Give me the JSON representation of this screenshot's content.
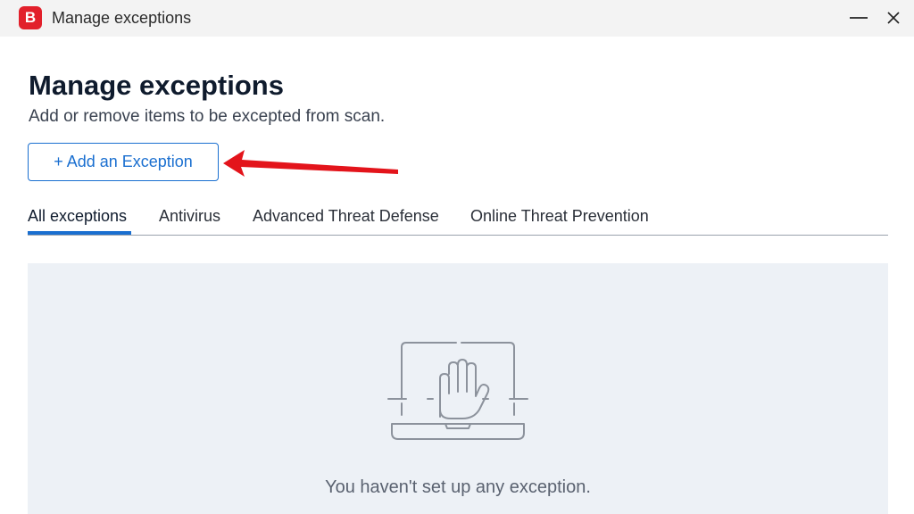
{
  "window": {
    "app_logo_letter": "B",
    "title": "Manage exceptions",
    "minimize_icon": "minimize-icon",
    "close_icon": "close-icon"
  },
  "header": {
    "title": "Manage exceptions",
    "subtitle": "Add or remove items to be excepted from scan."
  },
  "actions": {
    "add_exception_label": "+ Add an Exception"
  },
  "tabs": [
    {
      "label": "All exceptions",
      "active": true
    },
    {
      "label": "Antivirus",
      "active": false
    },
    {
      "label": "Advanced Threat Defense",
      "active": false
    },
    {
      "label": "Online Threat Prevention",
      "active": false
    }
  ],
  "empty_state": {
    "icon": "laptop-hand-stop-icon",
    "message": "You haven't set up any exception."
  },
  "colors": {
    "brand_red": "#e2202b",
    "accent_blue": "#1a6fd0",
    "panel_bg": "#edf1f6",
    "annotation_arrow": "#e3141b"
  }
}
